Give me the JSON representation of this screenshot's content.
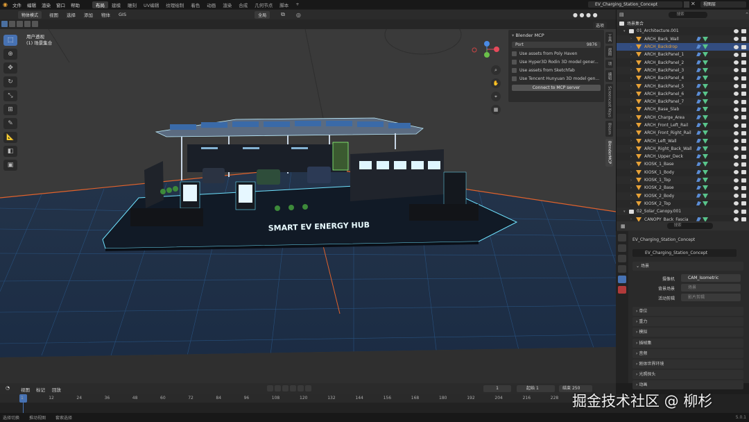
{
  "menu": [
    "文件",
    "编辑",
    "渲染",
    "窗口",
    "帮助"
  ],
  "workspaces": [
    {
      "label": "布局",
      "active": true
    },
    {
      "label": "建模",
      "active": false
    },
    {
      "label": "雕刻",
      "active": false
    },
    {
      "label": "UV编辑",
      "active": false
    },
    {
      "label": "纹理绘制",
      "active": false
    },
    {
      "label": "着色",
      "active": false
    },
    {
      "label": "动画",
      "active": false
    },
    {
      "label": "渲染",
      "active": false
    },
    {
      "label": "合成",
      "active": false
    },
    {
      "label": "几何节点",
      "active": false
    },
    {
      "label": "脚本",
      "active": false
    },
    {
      "label": "+",
      "active": false
    }
  ],
  "scene_name": "EV_Charging_Station_Concept",
  "view_layer": "视图层",
  "viewport_header": {
    "mode": "物体模式",
    "menus": [
      "视图",
      "选择",
      "添加",
      "物体",
      "GIS"
    ],
    "transform": "全局"
  },
  "viewport_info": {
    "line1": "用户透视",
    "line2": "(1) 场景集合"
  },
  "select_button": "选项",
  "mcp": {
    "title": "Blender MCP",
    "port_label": "Port",
    "port_value": "9876",
    "options": [
      {
        "label": "Use assets from Poly Haven",
        "checked": false
      },
      {
        "label": "Use Hyper3D Rodin 3D model gener...",
        "checked": false
      },
      {
        "label": "Use assets from Sketchfab",
        "checked": false
      },
      {
        "label": "Use Tencent Hunyuan 3D model gen...",
        "checked": false
      }
    ],
    "connect_label": "Connect to MCP server"
  },
  "side_tabs": [
    "工具",
    "视图",
    "项",
    "编辑",
    "Screencast Keys",
    "Blosm",
    "BlenderMCP"
  ],
  "scene_text": "SMART EV ENERGY HUB",
  "outliner": {
    "search_placeholder": "搜索",
    "root": "场景集合",
    "rows": [
      {
        "name": "01_Architecture.001",
        "type": "col",
        "indent": 1,
        "mods": false,
        "hl": false
      },
      {
        "name": "ARCH_Back_Wall",
        "type": "obj",
        "indent": 2,
        "mods": true,
        "hl": false
      },
      {
        "name": "ARCH_Backdrop",
        "type": "obj",
        "indent": 2,
        "mods": true,
        "hl": true
      },
      {
        "name": "ARCH_BackPanel_1",
        "type": "obj",
        "indent": 2,
        "mods": true,
        "hl": false
      },
      {
        "name": "ARCH_BackPanel_2",
        "type": "obj",
        "indent": 2,
        "mods": true,
        "hl": false
      },
      {
        "name": "ARCH_BackPanel_3",
        "type": "obj",
        "indent": 2,
        "mods": true,
        "hl": false
      },
      {
        "name": "ARCH_BackPanel_4",
        "type": "obj",
        "indent": 2,
        "mods": true,
        "hl": false
      },
      {
        "name": "ARCH_BackPanel_5",
        "type": "obj",
        "indent": 2,
        "mods": true,
        "hl": false
      },
      {
        "name": "ARCH_BackPanel_6",
        "type": "obj",
        "indent": 2,
        "mods": true,
        "hl": false
      },
      {
        "name": "ARCH_BackPanel_7",
        "type": "obj",
        "indent": 2,
        "mods": true,
        "hl": false
      },
      {
        "name": "ARCH_Base_Slab",
        "type": "obj",
        "indent": 2,
        "mods": true,
        "hl": false
      },
      {
        "name": "ARCH_Charge_Area",
        "type": "obj",
        "indent": 2,
        "mods": true,
        "hl": false
      },
      {
        "name": "ARCH_Front_Left_Rail",
        "type": "obj",
        "indent": 2,
        "mods": true,
        "hl": false
      },
      {
        "name": "ARCH_Front_Right_Rail",
        "type": "obj",
        "indent": 2,
        "mods": true,
        "hl": false
      },
      {
        "name": "ARCH_Left_Wall",
        "type": "obj",
        "indent": 2,
        "mods": true,
        "hl": false
      },
      {
        "name": "ARCH_Right_Back_Wall",
        "type": "obj",
        "indent": 2,
        "mods": true,
        "hl": false
      },
      {
        "name": "ARCH_Upper_Deck",
        "type": "obj",
        "indent": 2,
        "mods": true,
        "hl": false
      },
      {
        "name": "KIOSK_1_Base",
        "type": "obj",
        "indent": 2,
        "mods": true,
        "hl": false
      },
      {
        "name": "KIOSK_1_Body",
        "type": "obj",
        "indent": 2,
        "mods": true,
        "hl": false
      },
      {
        "name": "KIOSK_1_Top",
        "type": "obj",
        "indent": 2,
        "mods": true,
        "hl": false
      },
      {
        "name": "KIOSK_2_Base",
        "type": "obj",
        "indent": 2,
        "mods": true,
        "hl": false
      },
      {
        "name": "KIOSK_2_Body",
        "type": "obj",
        "indent": 2,
        "mods": true,
        "hl": false
      },
      {
        "name": "KIOSK_2_Top",
        "type": "obj",
        "indent": 2,
        "mods": true,
        "hl": false
      },
      {
        "name": "02_Solar_Canopy.001",
        "type": "col",
        "indent": 1,
        "mods": false,
        "hl": false
      },
      {
        "name": "CANOPY_Back_Fascia",
        "type": "obj",
        "indent": 2,
        "mods": true,
        "hl": false
      }
    ]
  },
  "properties": {
    "scene_name": "EV_Charging_Station_Concept",
    "scene_field": "EV_Charging_Station_Concept",
    "section_scene": "场景",
    "camera_label": "摄像机",
    "camera_value": "CAM_Isometric",
    "bg_label": "背景场景",
    "bg_placeholder": "场景",
    "clip_label": "活动剪辑",
    "clip_placeholder": "影片剪辑",
    "sections": [
      "单位",
      "重力",
      "模拟",
      "插帧集",
      "音频",
      "刚体世界环境",
      "光照探头",
      "动画"
    ]
  },
  "timeline": {
    "menus": [
      "视图",
      "标记",
      "回放"
    ],
    "current_frame": "1",
    "start_label": "起始",
    "start": "1",
    "end_label": "结束",
    "end": "250",
    "ticks": [
      "1",
      "12",
      "24",
      "36",
      "48",
      "60",
      "72",
      "84",
      "96",
      "108",
      "120",
      "132",
      "144",
      "156",
      "168",
      "180",
      "192",
      "204",
      "216",
      "228",
      "240"
    ]
  },
  "status": [
    "选择切换",
    "推动视图",
    "套索选择"
  ],
  "version": "5.0.1",
  "watermark": "掘金技术社区 @ 柳杉",
  "colors": {
    "accent": "#4772b3",
    "object_orange": "#e8a237",
    "neon": "#6fe3ff",
    "grid": "#2b5a8c"
  }
}
